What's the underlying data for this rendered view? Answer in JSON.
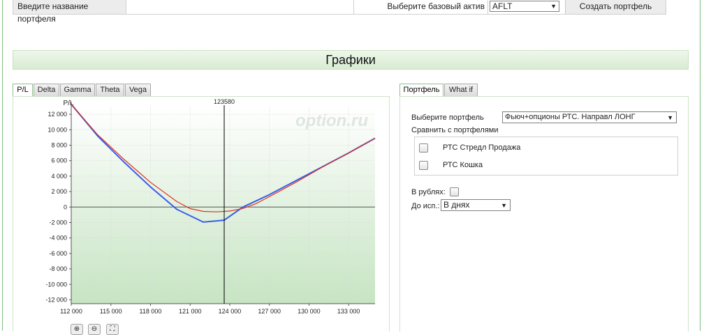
{
  "form": {
    "portfolio_name_label": "Введите название портфеля",
    "portfolio_name_value": "",
    "base_asset_label": "Выберите базовый актив",
    "base_asset_value": "AFLT",
    "create_button": "Создать портфель"
  },
  "section_title": "Графики",
  "chart_tabs": [
    {
      "label": "P/L",
      "active": true
    },
    {
      "label": "Delta",
      "active": false
    },
    {
      "label": "Gamma",
      "active": false
    },
    {
      "label": "Theta",
      "active": false
    },
    {
      "label": "Vega",
      "active": false
    }
  ],
  "right_tabs": [
    {
      "label": "Портфель",
      "active": true
    },
    {
      "label": "What if",
      "active": false
    }
  ],
  "portfolio_panel": {
    "select_label": "Выберите портфель",
    "select_value": "Фьюч+опционы РТС. Направл ЛОНГ",
    "compare_label": "Сравнить с портфелями",
    "compare_items": [
      {
        "label": "РТС Стредл Продажа",
        "checked": false
      },
      {
        "label": "РТС Кошка",
        "checked": false
      }
    ],
    "rubles_label": "В рублях:",
    "rubles_checked": false,
    "expiry_label": "До исп.:",
    "expiry_value": "В днях"
  },
  "chart_data": {
    "type": "line",
    "ylabel": "P/L",
    "watermark": "option.ru",
    "cursor_label": "123580",
    "cursor_x": 123580,
    "xlim": [
      112000,
      135000
    ],
    "ylim": [
      -12500,
      13000
    ],
    "x_ticks": [
      112000,
      115000,
      118000,
      121000,
      124000,
      127000,
      130000,
      133000
    ],
    "x_tick_labels": [
      "112 000",
      "115 000",
      "118 000",
      "121 000",
      "124 000",
      "127 000",
      "130 000",
      "133 000"
    ],
    "y_ticks": [
      12000,
      10000,
      8000,
      6000,
      4000,
      2000,
      0,
      -2000,
      -4000,
      -6000,
      -8000,
      -10000,
      -12000
    ],
    "y_tick_labels": [
      "12 000",
      "10 000",
      "8 000",
      "6 000",
      "4 000",
      "2 000",
      "0",
      "-2 000",
      "-4 000",
      "-6 000",
      "-8 000",
      "-10 000",
      "-12 000"
    ],
    "series": [
      {
        "color": "#3a5ee8",
        "x": [
          112000,
          114000,
          116000,
          118000,
          120000,
          122000,
          123580,
          125000,
          127000,
          129000,
          131000,
          133000,
          135000
        ],
        "y": [
          13300,
          9200,
          5800,
          2600,
          -300,
          -1950,
          -1700,
          0,
          1600,
          3400,
          5200,
          7000,
          8900
        ]
      },
      {
        "color": "#e03020",
        "x": [
          112000,
          114000,
          116000,
          118000,
          120000,
          121000,
          122000,
          123000,
          124000,
          125000,
          126000,
          127000,
          129000,
          131000,
          133000,
          135000
        ],
        "y": [
          13300,
          9350,
          6150,
          3200,
          700,
          -200,
          -560,
          -620,
          -520,
          -180,
          450,
          1350,
          3200,
          5150,
          7000,
          8900
        ]
      }
    ]
  }
}
